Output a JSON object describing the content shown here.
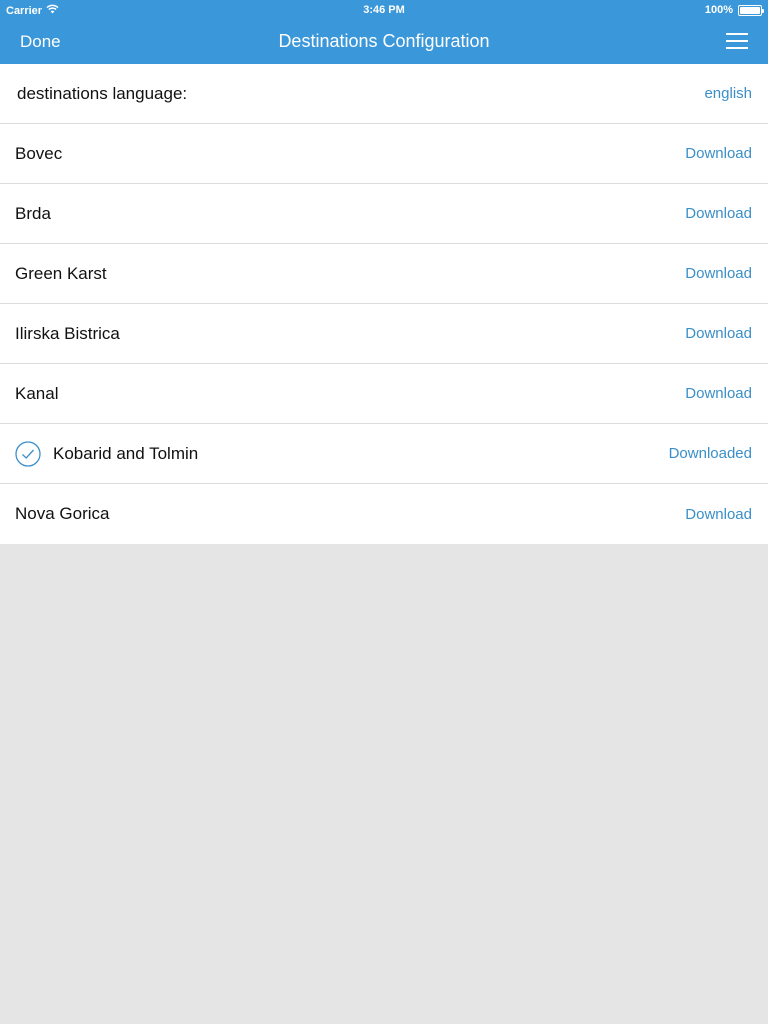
{
  "status_bar": {
    "carrier": "Carrier",
    "time": "3:46 PM",
    "battery": "100%"
  },
  "nav": {
    "done_label": "Done",
    "title": "Destinations Configuration",
    "menu_icon": "hamburger-menu-icon"
  },
  "language": {
    "label": "destinations language:",
    "value": "english"
  },
  "destinations": [
    {
      "name": "Bovec",
      "action": "Download",
      "downloaded": false
    },
    {
      "name": "Brda",
      "action": "Download",
      "downloaded": false
    },
    {
      "name": "Green Karst",
      "action": "Download",
      "downloaded": false
    },
    {
      "name": "Ilirska Bistrica",
      "action": "Download",
      "downloaded": false
    },
    {
      "name": "Kanal",
      "action": "Download",
      "downloaded": false
    },
    {
      "name": "Kobarid and Tolmin",
      "action": "Downloaded",
      "downloaded": true
    },
    {
      "name": "Nova Gorica",
      "action": "Download",
      "downloaded": false
    }
  ],
  "colors": {
    "header": "#3a97da",
    "link": "#3a8fc8",
    "background": "#e5e5e5"
  }
}
